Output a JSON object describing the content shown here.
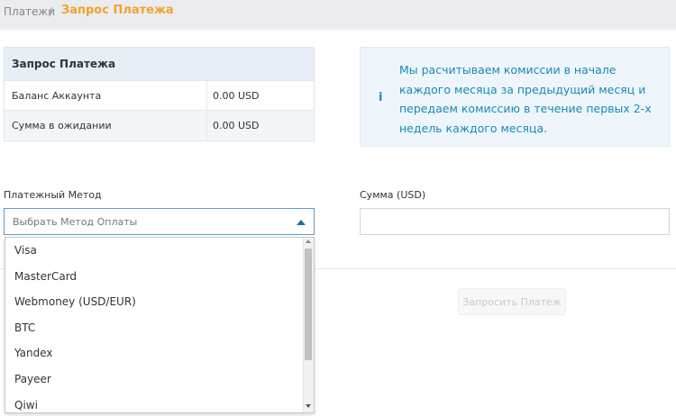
{
  "breadcrumb": {
    "root": "Платежи",
    "separator": "/",
    "current": "Запрос Платежа"
  },
  "balance_card": {
    "title": "Запрос Платежа",
    "rows": [
      {
        "label": "Баланс Аккаунта",
        "value": "0.00 USD"
      },
      {
        "label": "Сумма в ожидании",
        "value": "0.00 USD"
      }
    ]
  },
  "notice": {
    "icon": "info-icon",
    "icon_glyph": "i",
    "text": "Мы расчитываем комиссии в начале каждого месяца за предыдущий месяц и передаем комиссию в течение первых 2-х недель каждого месяца."
  },
  "form": {
    "method_label": "Платежный Метод",
    "method_placeholder": "Выбрать Метод Оплаты",
    "amount_label": "Сумма (USD)",
    "amount_value": "",
    "submit_label": "Запросить Платеж"
  },
  "dropdown": {
    "options": [
      "Visa",
      "MasterCard",
      "Webmoney (USD/EUR)",
      "BTC",
      "Yandex",
      "Payeer",
      "Qiwi"
    ]
  },
  "colors": {
    "accent_orange": "#f0a32c",
    "info_blue": "#1a88b8",
    "select_border": "#5d9cc4"
  }
}
